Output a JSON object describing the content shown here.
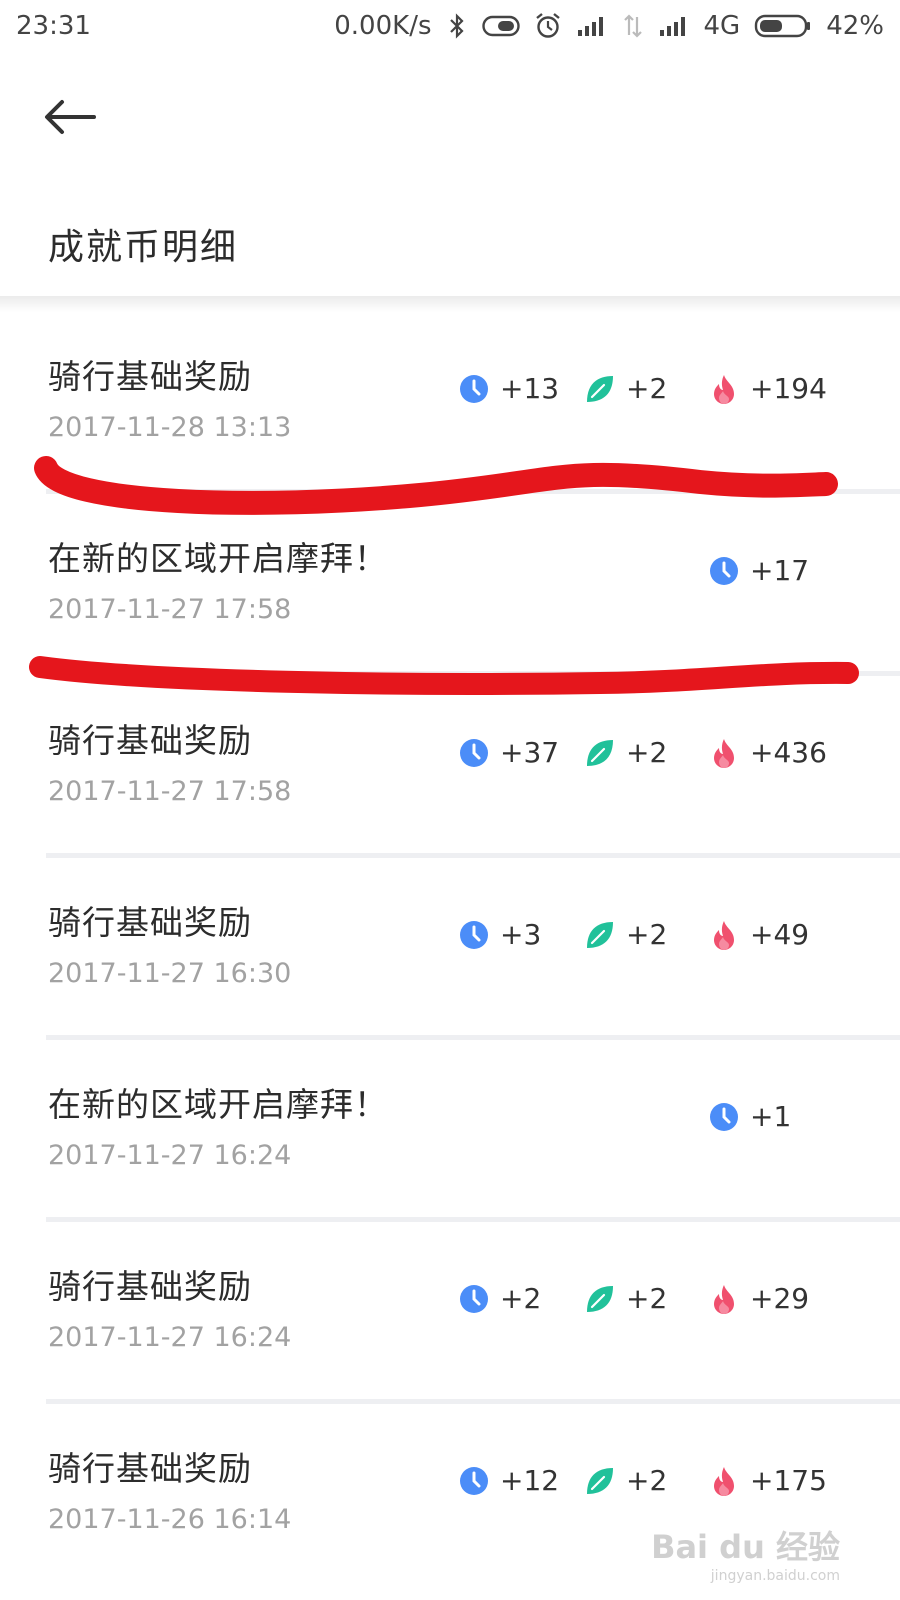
{
  "status_bar": {
    "time": "23:31",
    "speed": "0.00K/s",
    "network": "4G",
    "battery": "42%"
  },
  "header": {
    "title": "成就币明细"
  },
  "records": [
    {
      "title": "骑行基础奖励",
      "time": "2017-11-28 13:13",
      "time_reward": "+13",
      "leaf_reward": "+2",
      "fire_reward": "+194"
    },
    {
      "title": "在新的区域开启摩拜！",
      "time": "2017-11-27 17:58",
      "time_reward": "+17",
      "leaf_reward": null,
      "fire_reward": null
    },
    {
      "title": "骑行基础奖励",
      "time": "2017-11-27 17:58",
      "time_reward": "+37",
      "leaf_reward": "+2",
      "fire_reward": "+436"
    },
    {
      "title": "骑行基础奖励",
      "time": "2017-11-27 16:30",
      "time_reward": "+3",
      "leaf_reward": "+2",
      "fire_reward": "+49"
    },
    {
      "title": "在新的区域开启摩拜！",
      "time": "2017-11-27 16:24",
      "time_reward": "+1",
      "leaf_reward": null,
      "fire_reward": null
    },
    {
      "title": "骑行基础奖励",
      "time": "2017-11-27 16:24",
      "time_reward": "+2",
      "leaf_reward": "+2",
      "fire_reward": "+29"
    },
    {
      "title": "骑行基础奖励",
      "time": "2017-11-26 16:14",
      "time_reward": "+12",
      "leaf_reward": "+2",
      "fire_reward": "+175"
    }
  ],
  "colors": {
    "time_icon": "#4b8df8",
    "leaf_icon": "#21c19a",
    "fire_icon": "#f0506e",
    "annotation": "#e5161c"
  },
  "icons": {
    "back": "back-arrow-icon",
    "time": "clock-icon",
    "leaf": "leaf-icon",
    "fire": "flame-icon"
  },
  "watermark": {
    "main": "Bai du 经验",
    "sub": "jingyan.baidu.com"
  }
}
